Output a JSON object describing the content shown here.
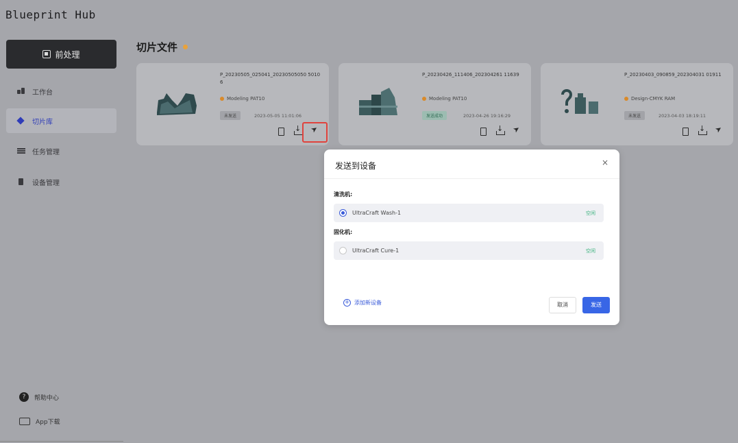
{
  "app": {
    "title": "Blueprint Hub"
  },
  "sidebar": {
    "primary_button": "前处理",
    "items": [
      {
        "label": "工作台",
        "icon": "workbench-icon",
        "active": false
      },
      {
        "label": "切片库",
        "icon": "slice-library-icon",
        "active": true
      },
      {
        "label": "任务管理",
        "icon": "task-list-icon",
        "active": false
      },
      {
        "label": "设备管理",
        "icon": "device-icon",
        "active": false
      }
    ],
    "help": "帮助中心",
    "app_download": "App下载"
  },
  "main": {
    "title": "切片文件",
    "cards": [
      {
        "filename": "P_20230505_025041_20230505050 50106",
        "printer": "Modeling PAT10",
        "status": "未发送",
        "date": "2023-05-05 11:01:06"
      },
      {
        "filename": "P_20230426_111406_202304261 11639",
        "printer": "Modeling PAT10",
        "status": "发送成功",
        "date": "2023-04-26 19:16:29"
      },
      {
        "filename": "P_20230403_090859_202304031 01911",
        "printer": "Design-CMYK RAM",
        "status": "未发送",
        "date": "2023-04-03 18:19:11"
      }
    ]
  },
  "modal": {
    "title": "发送到设备",
    "close": "×",
    "groups": [
      {
        "label": "清洗机:",
        "device": "UltraCraft Wash-1",
        "state": "空闲",
        "selected": true
      },
      {
        "label": "固化机:",
        "device": "UltraCraft Cure-1",
        "state": "空闲",
        "selected": false
      }
    ],
    "add_device": "添加新设备",
    "cancel": "取消",
    "send": "发送"
  },
  "colors": {
    "accent": "#3866e6",
    "highlight": "#e0423c",
    "idle_green": "#3fb37f",
    "status_dot": "#e9a23b"
  }
}
